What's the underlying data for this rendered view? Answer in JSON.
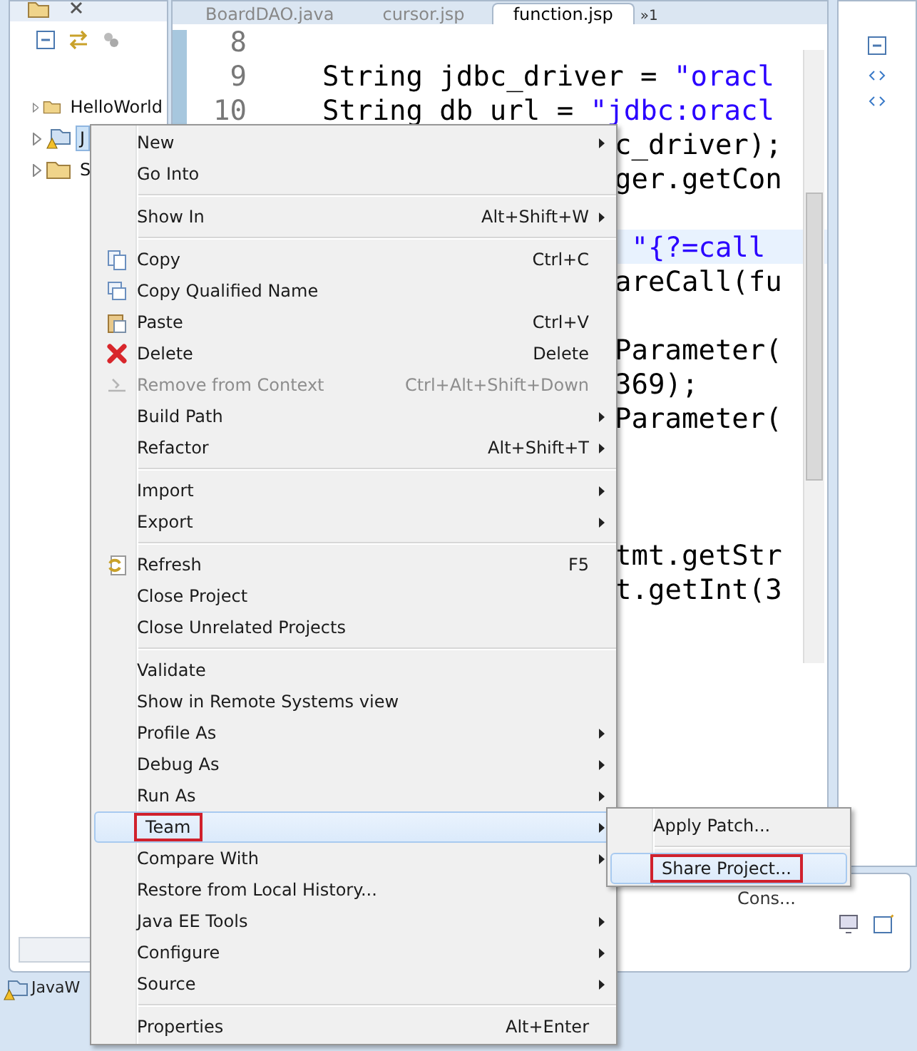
{
  "editor_tabs": [
    {
      "label": "BoardDAO.java",
      "selected": false
    },
    {
      "label": "cursor.jsp",
      "selected": false
    },
    {
      "label": "function.jsp",
      "selected": true
    }
  ],
  "editor_overflow": "»1",
  "explorer": {
    "items": [
      {
        "label": "HelloWorld",
        "selected": false,
        "kind": "folder"
      },
      {
        "label": "J",
        "selected": true,
        "kind": "project"
      },
      {
        "label": "S",
        "selected": false,
        "kind": "folder"
      }
    ]
  },
  "code_lines": [
    {
      "number": "8",
      "kind": "full",
      "current": false
    },
    {
      "number": "9",
      "kind": "full",
      "current": false,
      "parts": [
        {
          "text": "String jdbc_driver = ",
          "kind": "code"
        },
        {
          "text": "\"oracl",
          "kind": "string"
        }
      ]
    },
    {
      "number": "10",
      "kind": "full",
      "current": false,
      "parts": [
        {
          "text": "String db url = ",
          "kind": "code"
        },
        {
          "text": "\"jdbc:oracl",
          "kind": "string"
        }
      ]
    },
    {
      "kind": "clipped",
      "current": false,
      "parts": [
        {
          "text": "c_driver);",
          "kind": "code"
        }
      ]
    },
    {
      "kind": "clipped",
      "current": false,
      "parts": [
        {
          "text": "ger.getCon",
          "kind": "code"
        }
      ]
    },
    {
      "kind": "clipped",
      "current": false
    },
    {
      "kind": "clipped",
      "current": true,
      "parts": [
        {
          "text": " \"{?=call",
          "kind": "string"
        }
      ]
    },
    {
      "kind": "clipped",
      "current": false,
      "parts": [
        {
          "text": "areCall(fu",
          "kind": "code"
        }
      ]
    },
    {
      "kind": "clipped",
      "current": false
    },
    {
      "kind": "clipped",
      "current": false,
      "parts": [
        {
          "text": "Parameter(",
          "kind": "code"
        }
      ]
    },
    {
      "kind": "clipped",
      "current": false,
      "parts": [
        {
          "text": "369);",
          "kind": "code"
        }
      ]
    },
    {
      "kind": "clipped",
      "current": false,
      "parts": [
        {
          "text": "Parameter(",
          "kind": "code"
        }
      ]
    },
    {
      "kind": "clipped",
      "current": false
    },
    {
      "kind": "clipped",
      "current": false
    },
    {
      "kind": "clipped",
      "current": false
    },
    {
      "kind": "clipped",
      "current": false,
      "parts": [
        {
          "text": "tmt.getStr",
          "kind": "code"
        }
      ]
    },
    {
      "kind": "clipped",
      "current": false,
      "parts": [
        {
          "text": "t.getInt(3",
          "kind": "code"
        }
      ]
    }
  ],
  "bottom_panel": {
    "tabs": [
      {
        "label": "Cons...",
        "selected": true
      }
    ]
  },
  "status_item": "JavaW",
  "context_menu": {
    "groups": [
      [
        {
          "label": "New",
          "kind": "plain",
          "submenu": true,
          "disabled": false,
          "selected": false,
          "boxed": false
        },
        {
          "label": "Go Into",
          "kind": "plain",
          "submenu": false,
          "disabled": false,
          "selected": false,
          "boxed": false
        }
      ],
      [
        {
          "label": "Show In",
          "shortcut": "Alt+Shift+W",
          "kind": "plain",
          "submenu": true,
          "disabled": false,
          "selected": false,
          "boxed": false
        }
      ],
      [
        {
          "label": "Copy",
          "shortcut": "Ctrl+C",
          "kind": "copy",
          "submenu": false,
          "disabled": false,
          "selected": false,
          "boxed": false
        },
        {
          "label": "Copy Qualified Name",
          "kind": "copy-name",
          "submenu": false,
          "disabled": false,
          "selected": false,
          "boxed": false
        },
        {
          "label": "Paste",
          "shortcut": "Ctrl+V",
          "kind": "paste",
          "submenu": false,
          "disabled": false,
          "selected": false,
          "boxed": false
        },
        {
          "label": "Delete",
          "shortcut": "Delete",
          "kind": "delete",
          "submenu": false,
          "disabled": false,
          "selected": false,
          "boxed": false
        },
        {
          "label": "Remove from Context",
          "shortcut": "Ctrl+Alt+Shift+Down",
          "kind": "remove",
          "submenu": false,
          "disabled": true,
          "selected": false,
          "boxed": false
        },
        {
          "label": "Build Path",
          "kind": "plain",
          "submenu": true,
          "disabled": false,
          "selected": false,
          "boxed": false
        },
        {
          "label": "Refactor",
          "shortcut": "Alt+Shift+T",
          "kind": "plain",
          "submenu": true,
          "disabled": false,
          "selected": false,
          "boxed": false
        }
      ],
      [
        {
          "label": "Import",
          "kind": "plain",
          "submenu": true,
          "disabled": false,
          "selected": false,
          "boxed": false
        },
        {
          "label": "Export",
          "kind": "plain",
          "submenu": true,
          "disabled": false,
          "selected": false,
          "boxed": false
        }
      ],
      [
        {
          "label": "Refresh",
          "shortcut": "F5",
          "kind": "refresh",
          "submenu": false,
          "disabled": false,
          "selected": false,
          "boxed": false
        },
        {
          "label": "Close Project",
          "kind": "plain",
          "submenu": false,
          "disabled": false,
          "selected": false,
          "boxed": false
        },
        {
          "label": "Close Unrelated Projects",
          "kind": "plain",
          "submenu": false,
          "disabled": false,
          "selected": false,
          "boxed": false
        }
      ],
      [
        {
          "label": "Validate",
          "kind": "plain",
          "submenu": false,
          "disabled": false,
          "selected": false,
          "boxed": false
        },
        {
          "label": "Show in Remote Systems view",
          "kind": "plain",
          "submenu": false,
          "disabled": false,
          "selected": false,
          "boxed": false
        },
        {
          "label": "Profile As",
          "kind": "plain",
          "submenu": true,
          "disabled": false,
          "selected": false,
          "boxed": false
        },
        {
          "label": "Debug As",
          "kind": "plain",
          "submenu": true,
          "disabled": false,
          "selected": false,
          "boxed": false
        },
        {
          "label": "Run As",
          "kind": "plain",
          "submenu": true,
          "disabled": false,
          "selected": false,
          "boxed": false
        },
        {
          "label": "Team",
          "kind": "plain",
          "submenu": true,
          "disabled": false,
          "selected": true,
          "boxed": true
        },
        {
          "label": "Compare With",
          "kind": "plain",
          "submenu": true,
          "disabled": false,
          "selected": false,
          "boxed": false
        },
        {
          "label": "Restore from Local History...",
          "kind": "plain",
          "submenu": false,
          "disabled": false,
          "selected": false,
          "boxed": false
        },
        {
          "label": "Java EE Tools",
          "kind": "plain",
          "submenu": true,
          "disabled": false,
          "selected": false,
          "boxed": false
        },
        {
          "label": "Configure",
          "kind": "plain",
          "submenu": true,
          "disabled": false,
          "selected": false,
          "boxed": false
        },
        {
          "label": "Source",
          "kind": "plain",
          "submenu": true,
          "disabled": false,
          "selected": false,
          "boxed": false
        }
      ],
      [
        {
          "label": "Properties",
          "shortcut": "Alt+Enter",
          "kind": "plain",
          "submenu": false,
          "disabled": false,
          "selected": false,
          "boxed": false
        }
      ]
    ]
  },
  "submenu": {
    "groups": [
      [
        {
          "label": "Apply Patch...",
          "submenu": false,
          "disabled": false,
          "selected": false,
          "boxed": false
        }
      ],
      [
        {
          "label": "Share Project...",
          "submenu": false,
          "disabled": false,
          "selected": true,
          "boxed": true
        }
      ]
    ]
  }
}
